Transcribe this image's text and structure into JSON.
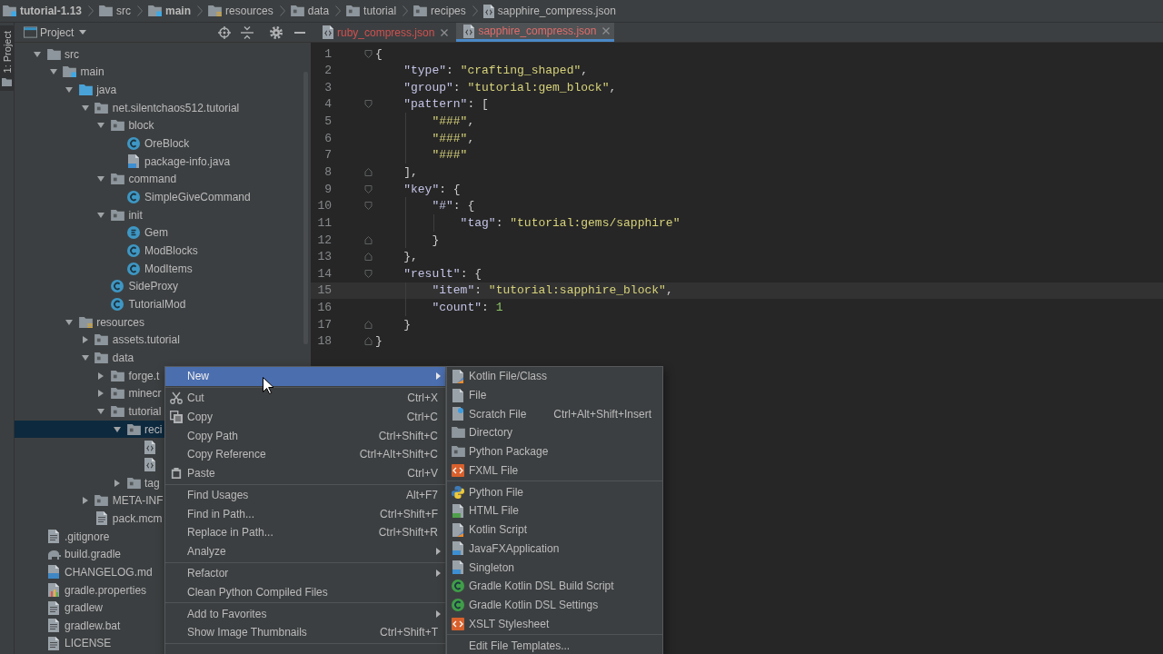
{
  "breadcrumbs": [
    {
      "label": "tutorial-1.13",
      "kind": "module"
    },
    {
      "label": "src",
      "kind": "folder"
    },
    {
      "label": "main",
      "kind": "module"
    },
    {
      "label": "resources",
      "kind": "resources"
    },
    {
      "label": "data",
      "kind": "package"
    },
    {
      "label": "tutorial",
      "kind": "package"
    },
    {
      "label": "recipes",
      "kind": "package"
    },
    {
      "label": "sapphire_compress.json",
      "kind": "json"
    }
  ],
  "tool_strip": {
    "label": "1: Project",
    "selected": true
  },
  "project": {
    "title": "Project",
    "tree": [
      {
        "label": "src",
        "kind": "folder",
        "expanded": true,
        "selected": false,
        "children": [
          {
            "label": "main",
            "kind": "module",
            "expanded": true,
            "selected": false,
            "children": [
              {
                "label": "java",
                "kind": "source-root",
                "expanded": true,
                "selected": false,
                "children": [
                  {
                    "label": "net.silentchaos512.tutorial",
                    "kind": "package",
                    "expanded": true,
                    "selected": false,
                    "children": [
                      {
                        "label": "block",
                        "kind": "package",
                        "expanded": true,
                        "selected": false,
                        "children": [
                          {
                            "label": "OreBlock",
                            "kind": "class",
                            "selected": false
                          },
                          {
                            "label": "package-info.java",
                            "kind": "java-file",
                            "selected": false
                          }
                        ]
                      },
                      {
                        "label": "command",
                        "kind": "package",
                        "expanded": true,
                        "selected": false,
                        "children": [
                          {
                            "label": "SimpleGiveCommand",
                            "kind": "class",
                            "selected": false
                          }
                        ]
                      },
                      {
                        "label": "init",
                        "kind": "package",
                        "expanded": true,
                        "selected": false,
                        "children": [
                          {
                            "label": "Gem",
                            "kind": "enum",
                            "selected": false
                          },
                          {
                            "label": "ModBlocks",
                            "kind": "class",
                            "selected": false
                          },
                          {
                            "label": "ModItems",
                            "kind": "class",
                            "selected": false
                          }
                        ]
                      },
                      {
                        "label": "SideProxy",
                        "kind": "class",
                        "selected": false
                      },
                      {
                        "label": "TutorialMod",
                        "kind": "class",
                        "selected": false
                      }
                    ]
                  }
                ]
              },
              {
                "label": "resources",
                "kind": "resources",
                "expanded": true,
                "selected": false,
                "children": [
                  {
                    "label": "assets.tutorial",
                    "kind": "package",
                    "expanded": false,
                    "selected": false
                  },
                  {
                    "label": "data",
                    "kind": "package",
                    "expanded": true,
                    "selected": false,
                    "children": [
                      {
                        "label": "forge.t",
                        "kind": "package",
                        "expanded": false,
                        "selected": false
                      },
                      {
                        "label": "minecr",
                        "kind": "package",
                        "expanded": false,
                        "selected": false
                      },
                      {
                        "label": "tutorial",
                        "kind": "package",
                        "expanded": true,
                        "selected": false,
                        "children": [
                          {
                            "label": "reci",
                            "kind": "package",
                            "expanded": true,
                            "selected": true,
                            "children": [
                              {
                                "kind": "json",
                                "selected": false
                              },
                              {
                                "kind": "json",
                                "selected": false
                              }
                            ]
                          },
                          {
                            "label": "tag",
                            "kind": "package",
                            "expanded": false,
                            "selected": false
                          }
                        ]
                      }
                    ]
                  },
                  {
                    "label": "META-INF",
                    "kind": "package",
                    "expanded": false,
                    "selected": false
                  },
                  {
                    "label": "pack.mcm",
                    "kind": "text",
                    "selected": false
                  }
                ]
              }
            ]
          }
        ]
      },
      {
        "label": ".gitignore",
        "kind": "text",
        "selected": false
      },
      {
        "label": "build.gradle",
        "kind": "gradle",
        "selected": false
      },
      {
        "label": "CHANGELOG.md",
        "kind": "markdown",
        "selected": false
      },
      {
        "label": "gradle.properties",
        "kind": "properties",
        "selected": false
      },
      {
        "label": "gradlew",
        "kind": "text",
        "selected": false
      },
      {
        "label": "gradlew.bat",
        "kind": "text",
        "selected": false
      },
      {
        "label": "LICENSE",
        "kind": "text",
        "selected": false
      }
    ]
  },
  "tabs": [
    {
      "label": "ruby_compress.json",
      "selected": false
    },
    {
      "label": "sapphire_compress.json",
      "selected": true
    }
  ],
  "editor": {
    "lines": [
      {
        "number": "1",
        "text": "{",
        "current": false
      },
      {
        "number": "2",
        "text": "    \"type\": \"crafting_shaped\",",
        "current": false
      },
      {
        "number": "3",
        "text": "    \"group\": \"tutorial:gem_block\",",
        "current": false
      },
      {
        "number": "4",
        "text": "    \"pattern\": [",
        "current": false
      },
      {
        "number": "5",
        "text": "        \"###\",",
        "current": false
      },
      {
        "number": "6",
        "text": "        \"###\",",
        "current": false
      },
      {
        "number": "7",
        "text": "        \"###\"",
        "current": false
      },
      {
        "number": "8",
        "text": "    ],",
        "current": false
      },
      {
        "number": "9",
        "text": "    \"key\": {",
        "current": false
      },
      {
        "number": "10",
        "text": "        \"#\": {",
        "current": false
      },
      {
        "number": "11",
        "text": "            \"tag\": \"tutorial:gems/sapphire\"",
        "current": false
      },
      {
        "number": "12",
        "text": "        }",
        "current": false
      },
      {
        "number": "13",
        "text": "    },",
        "current": false
      },
      {
        "number": "14",
        "text": "    \"result\": {",
        "current": false
      },
      {
        "number": "15",
        "text": "        \"item\": \"tutorial:sapphire_block\",",
        "current": true
      },
      {
        "number": "16",
        "text": "        \"count\": 1",
        "current": false
      },
      {
        "number": "17",
        "text": "    }",
        "current": false
      },
      {
        "number": "18",
        "text": "}",
        "current": false
      }
    ]
  },
  "context_menu": {
    "sections": [
      {
        "items": [
          {
            "label": "New",
            "kind": "plain",
            "submenu": true,
            "selected": true
          }
        ]
      },
      {
        "items": [
          {
            "label": "Cut",
            "kind": "scissors",
            "shortcut": "Ctrl+X",
            "submenu": false,
            "selected": false
          },
          {
            "label": "Copy",
            "kind": "copy",
            "shortcut": "Ctrl+C",
            "submenu": false,
            "selected": false
          },
          {
            "label": "Copy Path",
            "kind": "plain",
            "shortcut": "Ctrl+Shift+C",
            "submenu": false,
            "selected": false
          },
          {
            "label": "Copy Reference",
            "kind": "plain",
            "shortcut": "Ctrl+Alt+Shift+C",
            "submenu": false,
            "selected": false
          },
          {
            "label": "Paste",
            "kind": "clipboard",
            "shortcut": "Ctrl+V",
            "submenu": false,
            "selected": false
          }
        ]
      },
      {
        "items": [
          {
            "label": "Find Usages",
            "kind": "plain",
            "shortcut": "Alt+F7",
            "submenu": false,
            "selected": false
          },
          {
            "label": "Find in Path...",
            "kind": "plain",
            "shortcut": "Ctrl+Shift+F",
            "submenu": false,
            "selected": false
          },
          {
            "label": "Replace in Path...",
            "kind": "plain",
            "shortcut": "Ctrl+Shift+R",
            "submenu": false,
            "selected": false
          },
          {
            "label": "Analyze",
            "kind": "plain",
            "submenu": true,
            "selected": false
          }
        ]
      },
      {
        "items": [
          {
            "label": "Refactor",
            "kind": "plain",
            "submenu": true,
            "selected": false
          },
          {
            "label": "Clean Python Compiled Files",
            "kind": "plain",
            "submenu": false,
            "selected": false
          }
        ]
      },
      {
        "items": [
          {
            "label": "Add to Favorites",
            "kind": "plain",
            "submenu": true,
            "selected": false
          },
          {
            "label": "Show Image Thumbnails",
            "kind": "plain",
            "shortcut": "Ctrl+Shift+T",
            "submenu": false,
            "selected": false
          }
        ]
      }
    ]
  },
  "submenu": {
    "sections": [
      {
        "items": [
          {
            "label": "Kotlin File/Class",
            "kind": "kotlin",
            "selected": false
          },
          {
            "label": "File",
            "kind": "file",
            "selected": false
          },
          {
            "label": "Scratch File",
            "kind": "scratch",
            "shortcut": "Ctrl+Alt+Shift+Insert",
            "selected": false
          },
          {
            "label": "Directory",
            "kind": "folder",
            "selected": false
          },
          {
            "label": "Python Package",
            "kind": "package",
            "selected": false
          },
          {
            "label": "FXML File",
            "kind": "xml",
            "selected": false
          }
        ]
      },
      {
        "items": [
          {
            "label": "Python File",
            "kind": "python",
            "selected": false
          },
          {
            "label": "HTML File",
            "kind": "html",
            "selected": false
          },
          {
            "label": "Kotlin Script",
            "kind": "kotlin",
            "selected": false
          },
          {
            "label": "JavaFXApplication",
            "kind": "java",
            "selected": false
          },
          {
            "label": "Singleton",
            "kind": "java",
            "selected": false
          },
          {
            "label": "Gradle Kotlin DSL Build Script",
            "kind": "gradle-kts",
            "selected": false
          },
          {
            "label": "Gradle Kotlin DSL Settings",
            "kind": "gradle-kts",
            "selected": false
          },
          {
            "label": "XSLT Stylesheet",
            "kind": "xml",
            "selected": false
          }
        ]
      },
      {
        "items": [
          {
            "label": "Edit File Templates...",
            "kind": "plain",
            "selected": false
          }
        ]
      }
    ]
  }
}
